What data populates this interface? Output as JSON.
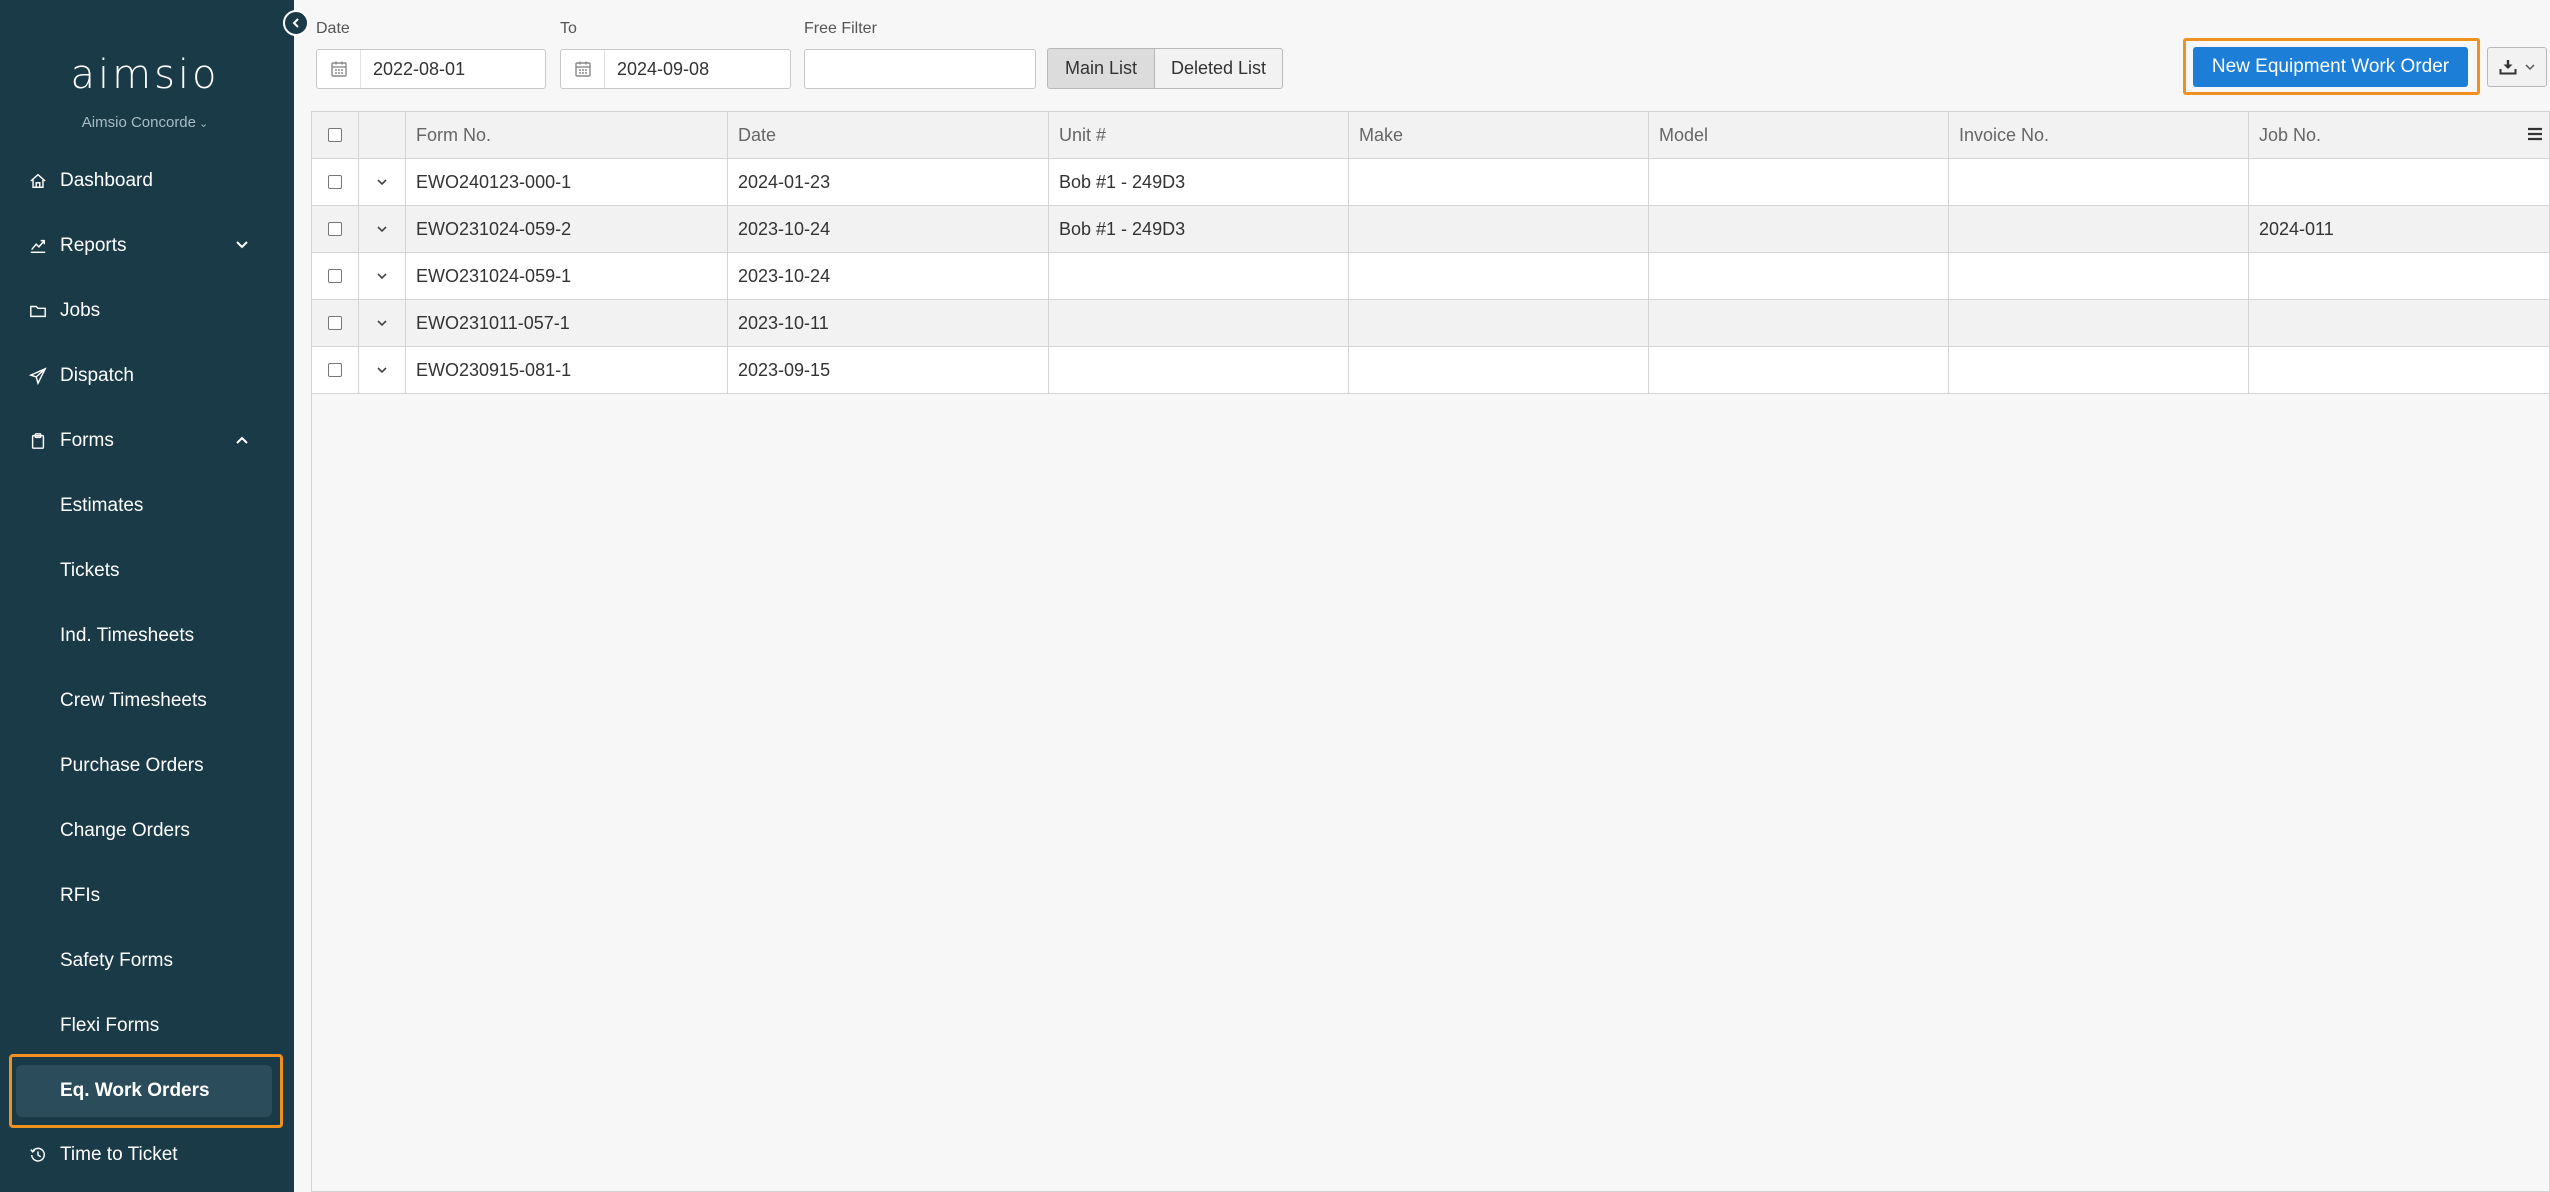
{
  "sidebar": {
    "logo_text": "aimsio",
    "company": "Aimsio Concorde",
    "nav": [
      {
        "label": "Dashboard",
        "icon": "home-icon"
      },
      {
        "label": "Reports",
        "icon": "chart-icon",
        "expandable": true,
        "expanded": false
      },
      {
        "label": "Jobs",
        "icon": "folder-icon"
      },
      {
        "label": "Dispatch",
        "icon": "paper-plane-icon"
      },
      {
        "label": "Forms",
        "icon": "clipboard-icon",
        "expandable": true,
        "expanded": true
      }
    ],
    "forms_items": [
      "Estimates",
      "Tickets",
      "Ind. Timesheets",
      "Crew Timesheets",
      "Purchase Orders",
      "Change Orders",
      "RFIs",
      "Safety Forms",
      "Flexi Forms",
      "Eq. Work Orders"
    ],
    "active_item": "Eq. Work Orders",
    "bottom_item": {
      "label": "Time to Ticket",
      "icon": "clock-history-icon"
    }
  },
  "filters": {
    "date_label": "Date",
    "date_value": "2022-08-01",
    "to_label": "To",
    "to_value": "2024-09-08",
    "free_filter_label": "Free Filter",
    "free_filter_value": ""
  },
  "list_toggle": {
    "main_label": "Main List",
    "deleted_label": "Deleted List",
    "selected": "Main List"
  },
  "actions": {
    "new_button": "New Equipment Work Order"
  },
  "table": {
    "columns": [
      "Form No.",
      "Date",
      "Unit #",
      "Make",
      "Model",
      "Invoice No.",
      "Job No."
    ],
    "rows": [
      [
        "EWO240123-000-1",
        "2024-01-23",
        "Bob #1 - 249D3",
        "",
        "",
        "",
        ""
      ],
      [
        "EWO231024-059-2",
        "2023-10-24",
        "Bob #1 - 249D3",
        "",
        "",
        "",
        "2024-011"
      ],
      [
        "EWO231024-059-1",
        "2023-10-24",
        "",
        "",
        "",
        "",
        ""
      ],
      [
        "EWO231011-057-1",
        "2023-10-11",
        "",
        "",
        "",
        "",
        ""
      ],
      [
        "EWO230915-081-1",
        "2023-09-15",
        "",
        "",
        "",
        "",
        ""
      ]
    ]
  },
  "colors": {
    "sidebar_bg": "#1a3a47",
    "accent_blue": "#1c7ed6",
    "highlight_orange": "#f0901f"
  }
}
